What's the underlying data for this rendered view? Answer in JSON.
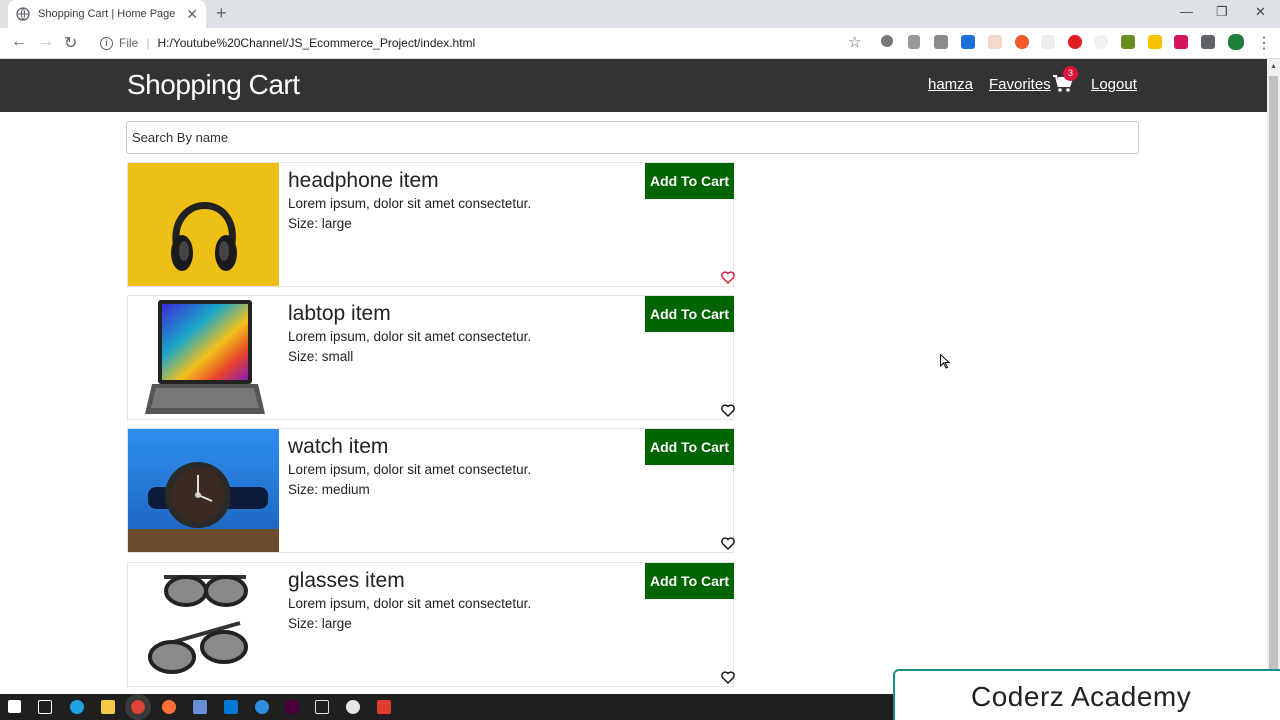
{
  "browser": {
    "tab_title": "Shopping Cart | Home Page",
    "url_prefix": "File",
    "url": "H:/Youtube%20Channel/JS_Ecommerce_Project/index.html"
  },
  "header": {
    "brand": "Shopping Cart",
    "user": "hamza",
    "favorites": "Favorites",
    "cart_count": "3",
    "logout": "Logout"
  },
  "search": {
    "placeholder": "Search By name"
  },
  "products": [
    {
      "name": "headphone item",
      "desc": "Lorem ipsum, dolor sit amet consectetur.",
      "size": "Size: large",
      "button": "Add To Cart",
      "favorite": true
    },
    {
      "name": "labtop item",
      "desc": "Lorem ipsum, dolor sit amet consectetur.",
      "size": "Size: small",
      "button": "Add To Cart",
      "favorite": false
    },
    {
      "name": "watch item",
      "desc": "Lorem ipsum, dolor sit amet consectetur.",
      "size": "Size: medium",
      "button": "Add To Cart",
      "favorite": false
    },
    {
      "name": "glasses item",
      "desc": "Lorem ipsum, dolor sit amet consectetur.",
      "size": "Size: large",
      "button": "Add To Cart",
      "favorite": false
    }
  ],
  "watermark": "Coderz Academy",
  "colors": {
    "header_bg": "#333333",
    "button_bg": "#006400",
    "badge": "#dc143c",
    "heart_active": "#dc143c"
  }
}
